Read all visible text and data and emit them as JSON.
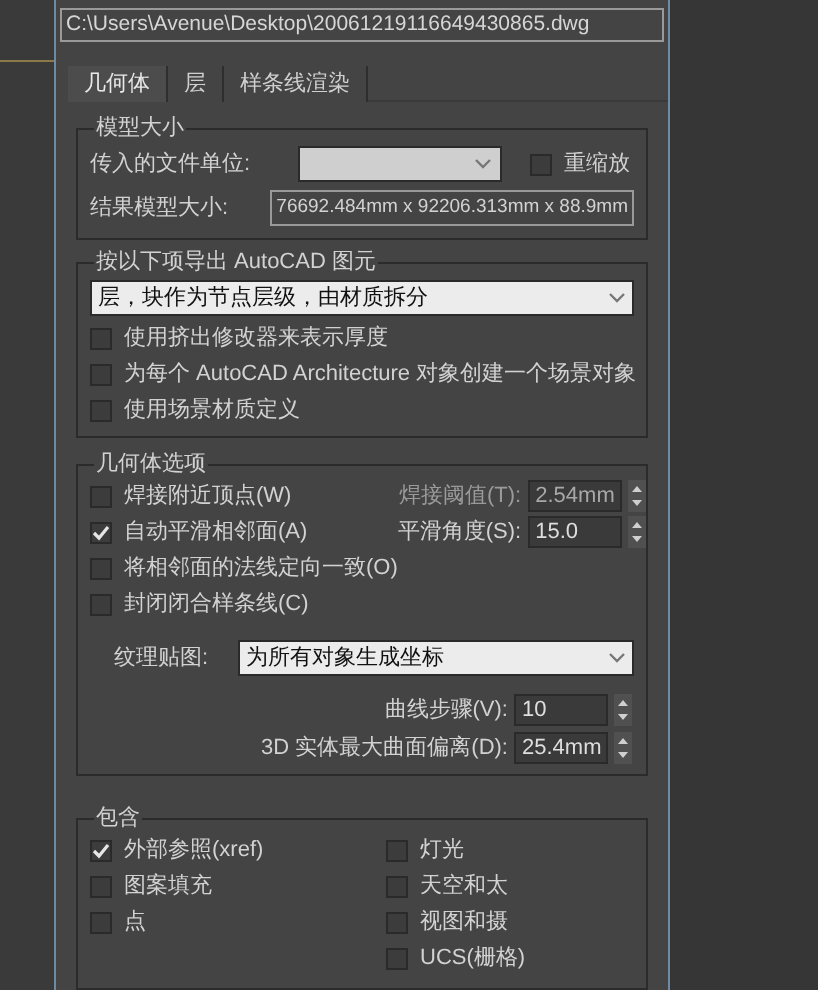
{
  "file_path": "C:\\Users\\Avenue\\Desktop\\20061219116649430865.dwg",
  "tabs": [
    {
      "label": "几何体",
      "selected": true
    },
    {
      "label": "层",
      "selected": false
    },
    {
      "label": "样条线渲染",
      "selected": false
    }
  ],
  "model_size": {
    "title": "模型大小",
    "unit_label": "传入的文件单位:",
    "unit_dropdown": {
      "disabled": true
    },
    "rescale": {
      "label": "重缩放",
      "checked": false
    },
    "result_label": "结果模型大小:",
    "result_value": "76692.484mm x 92206.313mm x 88.9mm"
  },
  "export": {
    "title": "按以下项导出 AutoCAD 图元",
    "dropdown_value": "层，块作为节点层级，由材质拆分",
    "options": [
      {
        "label": "使用挤出修改器来表示厚度",
        "checked": false
      },
      {
        "label": "为每个 AutoCAD Architecture 对象创建一个场景对象",
        "checked": false
      },
      {
        "label": "使用场景材质定义",
        "checked": false
      }
    ]
  },
  "geometry": {
    "title": "几何体选项",
    "options": [
      {
        "label": "焊接附近顶点(W)",
        "checked": false
      },
      {
        "label": "自动平滑相邻面(A)",
        "checked": true
      },
      {
        "label": "将相邻面的法线定向一致(O)",
        "checked": false
      },
      {
        "label": "封闭闭合样条线(C)",
        "checked": false
      }
    ],
    "side_params": [
      {
        "label": "焊接阈值(T):",
        "value": "2.54mm",
        "disabled": true
      },
      {
        "label": "平滑角度(S):",
        "value": "15.0",
        "disabled": false
      }
    ],
    "texture_label": "纹理贴图:",
    "texture_value": "为所有对象生成坐标",
    "bottom_params": [
      {
        "label": "曲线步骤(V):",
        "value": "10",
        "disabled": false
      },
      {
        "label": "3D 实体最大曲面偏离(D):",
        "value": "25.4mm",
        "disabled": false
      }
    ]
  },
  "include": {
    "title": "包含",
    "left": [
      {
        "label": "外部参照(xref)",
        "checked": true
      },
      {
        "label": "图案填充",
        "checked": false
      },
      {
        "label": "点",
        "checked": false
      }
    ],
    "right": [
      {
        "label": "灯光",
        "checked": false
      },
      {
        "label": "天空和太",
        "checked": false
      },
      {
        "label": "视图和摄",
        "checked": false
      },
      {
        "label": "UCS(栅格)",
        "checked": false
      }
    ]
  }
}
